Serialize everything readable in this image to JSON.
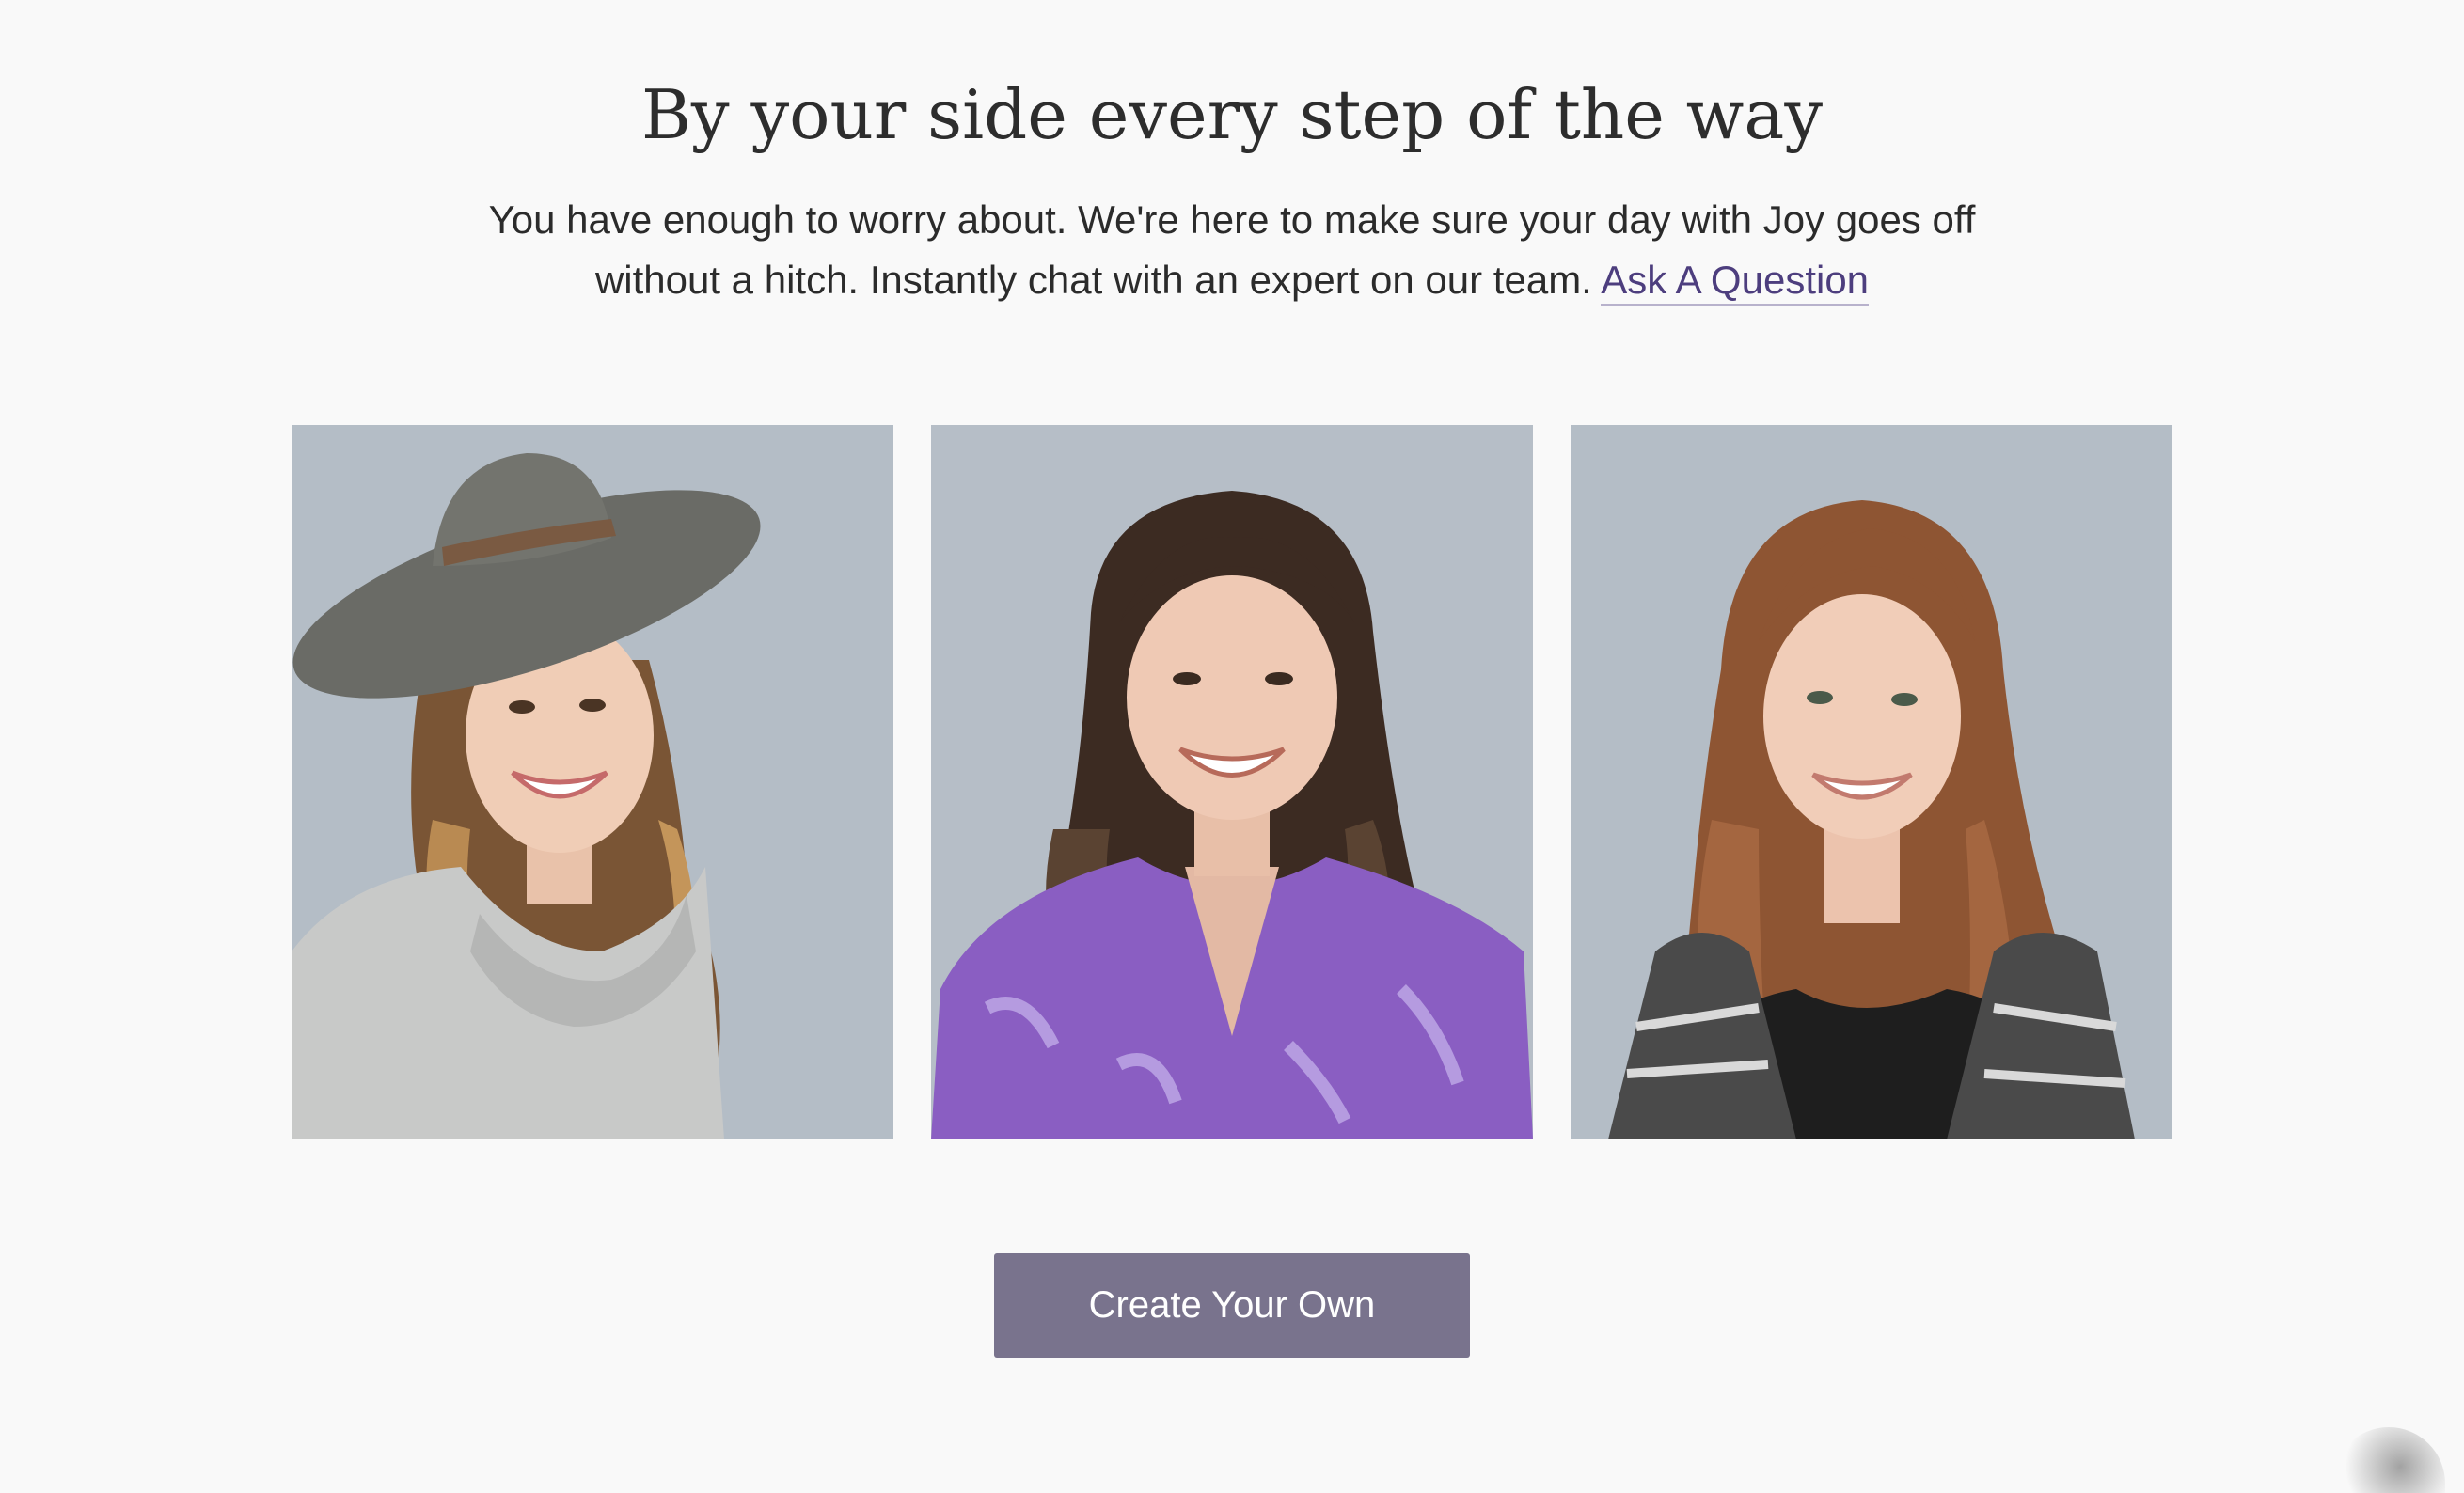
{
  "section": {
    "title": "By your side every step of the way",
    "intro_text": "You have enough to worry about. We're here to make sure your day with Joy goes off without a hitch. Instantly chat with an expert on our team.",
    "ask_link_label": "Ask A Question"
  },
  "team_photos": [
    {
      "icon": "portrait-woman-hat-grey-sweater",
      "background": "#b4bdc6"
    },
    {
      "icon": "portrait-woman-purple-blouse",
      "background": "#b4bdc6"
    },
    {
      "icon": "portrait-woman-auburn-hair",
      "background": "#b4bdc6"
    }
  ],
  "cta": {
    "label": "Create Your Own"
  },
  "colors": {
    "page_background": "#f9f9f9",
    "link": "#4d3e7e",
    "button_background": "#79738d",
    "button_text": "#ffffff",
    "photo_background": "#b4bdc6"
  }
}
